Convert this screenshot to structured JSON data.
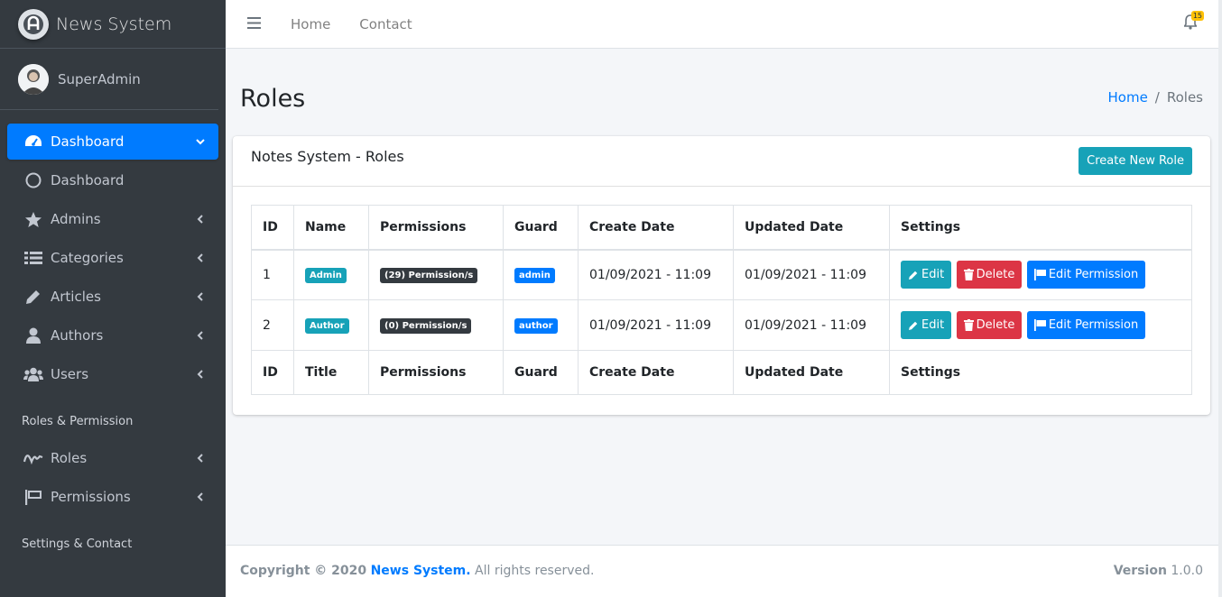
{
  "brand": {
    "name": "News System",
    "icon": "brand-logo-icon"
  },
  "user": {
    "name": "SuperAdmin"
  },
  "sidebar": {
    "items": [
      {
        "label": "Dashboard",
        "icon": "tachometer-icon",
        "active": true
      },
      {
        "label": "Dashboard",
        "icon": "circle-icon"
      },
      {
        "label": "Admins",
        "icon": "star-icon"
      },
      {
        "label": "Categories",
        "icon": "list-icon"
      },
      {
        "label": "Articles",
        "icon": "pencil-icon"
      },
      {
        "label": "Authors",
        "icon": "user-icon"
      },
      {
        "label": "Users",
        "icon": "users-icon"
      }
    ],
    "header_roles": "Roles & Permission",
    "roles_items": [
      {
        "label": "Roles",
        "icon": "signature-icon"
      },
      {
        "label": "Permissions",
        "icon": "flag-icon"
      }
    ],
    "header_settings": "Settings & Contact"
  },
  "topbar": {
    "home": "Home",
    "contact": "Contact",
    "notifications": "15"
  },
  "page": {
    "title": "Roles",
    "breadcrumb": {
      "home": "Home",
      "separator": "/",
      "current": "Roles"
    }
  },
  "card": {
    "title": "Notes System - Roles",
    "create_button": "Create New Role"
  },
  "table": {
    "headers": [
      "ID",
      "Name",
      "Permissions",
      "Guard",
      "Create Date",
      "Updated Date",
      "Settings"
    ],
    "footers": [
      "ID",
      "Title",
      "Permissions",
      "Guard",
      "Create Date",
      "Updated Date",
      "Settings"
    ],
    "rows": [
      {
        "id": "1",
        "name": "Admin",
        "permissions": "(29) Permission/s",
        "guard": "admin",
        "created": "01/09/2021 - 11:09",
        "updated": "01/09/2021 - 11:09"
      },
      {
        "id": "2",
        "name": "Author",
        "permissions": "(0) Permission/s",
        "guard": "author",
        "created": "01/09/2021 - 11:09",
        "updated": "01/09/2021 - 11:09"
      }
    ],
    "actions": {
      "edit": "Edit",
      "delete": "Delete",
      "edit_permission": "Edit Permission"
    }
  },
  "footer": {
    "copyright": "Copyright © 2020",
    "brand": "News System.",
    "rights": "All rights reserved.",
    "version_label": "Version",
    "version": "1.0.0"
  },
  "colors": {
    "primary": "#007bff",
    "info": "#17a2b8",
    "danger": "#dc3545",
    "sidebar": "#343a40",
    "warning": "#ffc107"
  }
}
